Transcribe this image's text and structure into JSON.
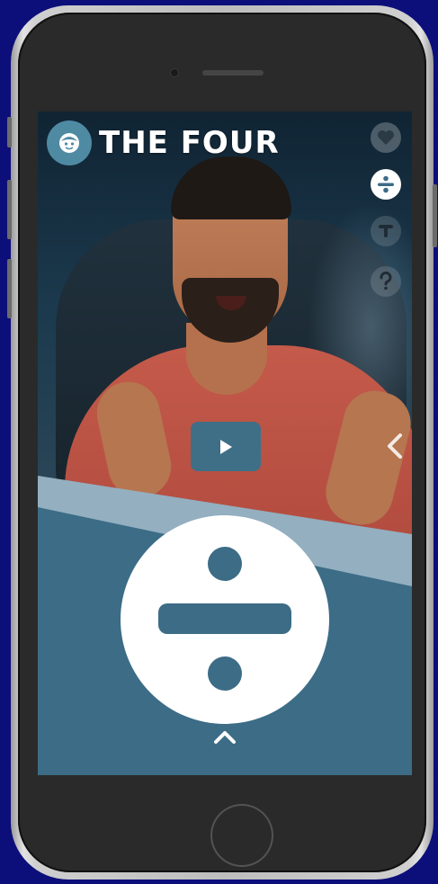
{
  "app": {
    "brand_title": "THE FOUR",
    "brand_logo_icon": "face-logo-icon"
  },
  "side_toolbar": [
    {
      "id": "favorite",
      "icon": "heart-icon",
      "state": "inactive"
    },
    {
      "id": "divide",
      "icon": "divide-icon",
      "state": "active"
    },
    {
      "id": "fourth",
      "icon": "t-shape-icon",
      "state": "inactive"
    },
    {
      "id": "help",
      "icon": "question-icon",
      "state": "inactive"
    }
  ],
  "video": {
    "play_icon": "play-icon"
  },
  "navigation": {
    "previous_icon": "chevron-left-icon",
    "expand_icon": "chevron-up-icon"
  },
  "operation_card": {
    "symbol_icon": "divide-icon"
  },
  "colors": {
    "accent": "#4f8aa3",
    "panel_dark": "#3c6c86",
    "panel_light": "#93afc0",
    "shirt": "#c45a4a",
    "background": "#0c0f7a"
  }
}
